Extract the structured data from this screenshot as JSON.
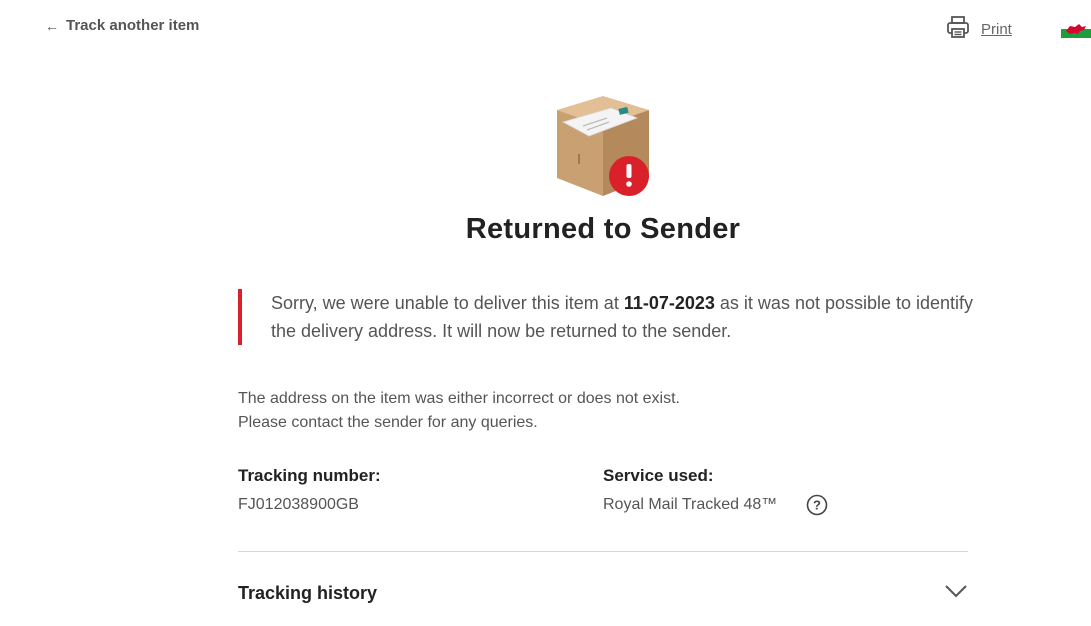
{
  "header": {
    "back_label": "Track another item",
    "print_label": "Print"
  },
  "status": {
    "title": "Returned to Sender",
    "message_before": "Sorry, we were unable to deliver this item at ",
    "message_date": "11-07-2023",
    "message_after": " as it was not possible to identify the delivery address. It will now be returned to the sender.",
    "explain_line1": "The address on the item was either incorrect or does not exist.",
    "explain_line2": "Please contact the sender for any queries."
  },
  "details": {
    "tracking_label": "Tracking number:",
    "tracking_value": "FJ012038900GB",
    "service_label": "Service used:",
    "service_value": "Royal Mail Tracked 48™"
  },
  "history": {
    "title": "Tracking history"
  },
  "colors": {
    "accent_red": "#da202a",
    "text_dark": "#222222",
    "text_muted": "#555555"
  },
  "icons": {
    "back": "arrow-left-icon",
    "print": "printer-icon",
    "flag": "welsh-flag-icon",
    "status": "parcel-alert-icon",
    "help": "question-circle-icon",
    "expand": "chevron-down-icon"
  }
}
